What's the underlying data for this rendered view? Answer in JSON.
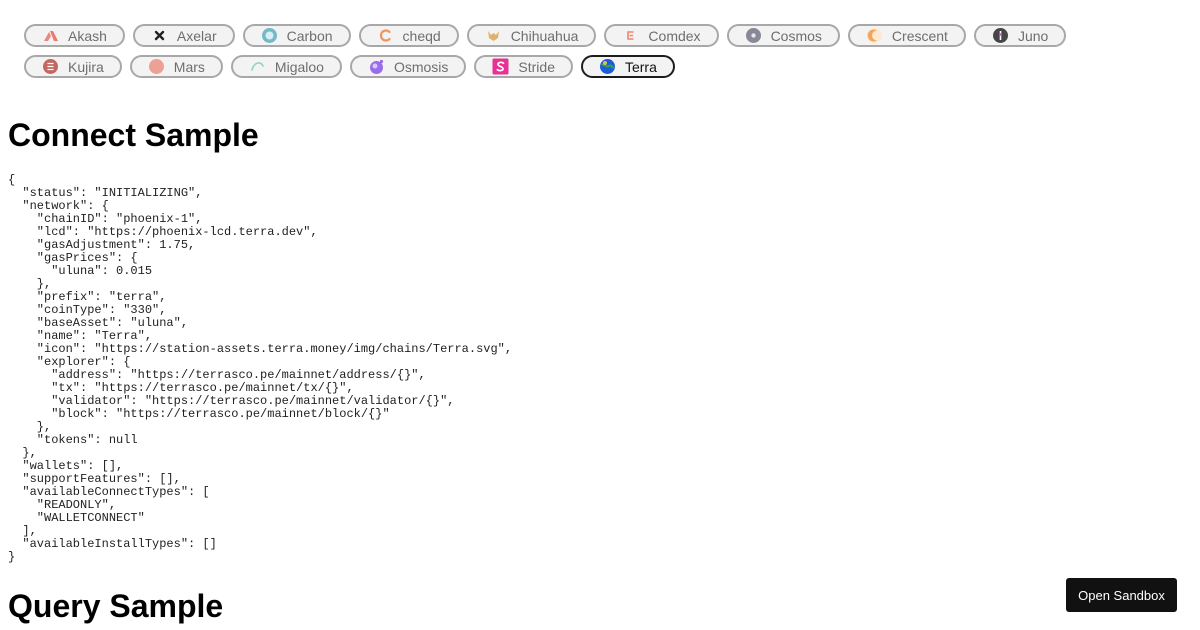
{
  "chains": [
    {
      "label": "Akash",
      "icon": "akash-logo-icon",
      "color": "#e8594a"
    },
    {
      "label": "Axelar",
      "icon": "axelar-logo-icon",
      "color": "#222222"
    },
    {
      "label": "Carbon",
      "icon": "carbon-logo-icon",
      "color": "#4aa6b8"
    },
    {
      "label": "cheqd",
      "icon": "cheqd-logo-icon",
      "color": "#f07a3a"
    },
    {
      "label": "Chihuahua",
      "icon": "chihuahua-logo-icon",
      "color": "#d9a24a"
    },
    {
      "label": "Comdex",
      "icon": "comdex-logo-icon",
      "color": "#f06a4a"
    },
    {
      "label": "Cosmos",
      "icon": "cosmos-logo-icon",
      "color": "#2e3148"
    },
    {
      "label": "Crescent",
      "icon": "crescent-logo-icon",
      "color": "#f2a65a"
    },
    {
      "label": "Juno",
      "icon": "juno-logo-icon",
      "color": "#1a1a1a"
    },
    {
      "label": "Kujira",
      "icon": "kujira-logo-icon",
      "color": "#b5453f"
    },
    {
      "label": "Mars",
      "icon": "mars-logo-icon",
      "color": "#e86a5a"
    },
    {
      "label": "Migaloo",
      "icon": "migaloo-logo-icon",
      "color": "#8fd3c8"
    },
    {
      "label": "Osmosis",
      "icon": "osmosis-logo-icon",
      "color": "#7b3fe4"
    },
    {
      "label": "Stride",
      "icon": "stride-logo-icon",
      "color": "#e5007d"
    },
    {
      "label": "Terra",
      "icon": "terra-logo-icon",
      "color": "#1e5bd6",
      "selected": true
    }
  ],
  "connect_title": "Connect Sample",
  "connect_json": "{\n  \"status\": \"INITIALIZING\",\n  \"network\": {\n    \"chainID\": \"phoenix-1\",\n    \"lcd\": \"https://phoenix-lcd.terra.dev\",\n    \"gasAdjustment\": 1.75,\n    \"gasPrices\": {\n      \"uluna\": 0.015\n    },\n    \"prefix\": \"terra\",\n    \"coinType\": \"330\",\n    \"baseAsset\": \"uluna\",\n    \"name\": \"Terra\",\n    \"icon\": \"https://station-assets.terra.money/img/chains/Terra.svg\",\n    \"explorer\": {\n      \"address\": \"https://terrasco.pe/mainnet/address/{}\",\n      \"tx\": \"https://terrasco.pe/mainnet/tx/{}\",\n      \"validator\": \"https://terrasco.pe/mainnet/validator/{}\",\n      \"block\": \"https://terrasco.pe/mainnet/block/{}\"\n    },\n    \"tokens\": null\n  },\n  \"wallets\": [],\n  \"supportFeatures\": [],\n  \"availableConnectTypes\": [\n    \"READONLY\",\n    \"WALLETCONNECT\"\n  ],\n  \"availableInstallTypes\": []\n}",
  "query_title": "Query Sample",
  "sandbox_label": "Open Sandbox"
}
